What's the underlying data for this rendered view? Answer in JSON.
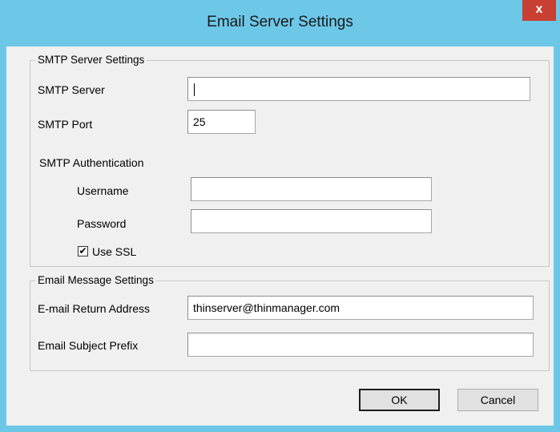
{
  "window": {
    "title": "Email Server Settings",
    "close_glyph": "x"
  },
  "smtp": {
    "legend": "SMTP Server Settings",
    "server_label": "SMTP Server",
    "server_value": "",
    "port_label": "SMTP Port",
    "port_value": "25",
    "auth_label": "SMTP Authentication",
    "username_label": "Username",
    "username_value": "",
    "password_label": "Password",
    "password_value": "",
    "ssl_label": "Use SSL",
    "ssl_checked": true,
    "ssl_check_glyph": "✔"
  },
  "message": {
    "legend": "Email Message Settings",
    "return_label": "E-mail Return Address",
    "return_value": "thinserver@thinmanager.com",
    "prefix_label": "Email Subject Prefix",
    "prefix_value": ""
  },
  "buttons": {
    "ok": "OK",
    "cancel": "Cancel"
  },
  "colors": {
    "titlebar": "#6dc8e8",
    "close": "#c84031",
    "dialog_bg": "#f0f0f0"
  }
}
